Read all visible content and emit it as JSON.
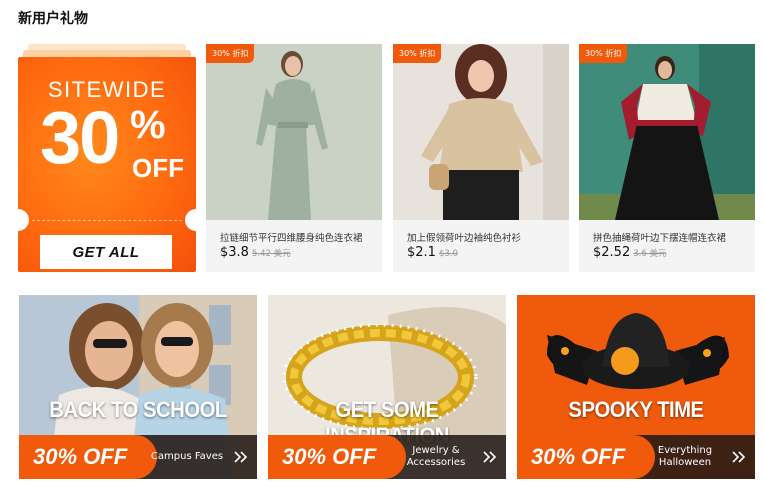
{
  "section": {
    "title": "新用户礼物"
  },
  "coupon": {
    "sitewide": "SITEWIDE",
    "number": "30",
    "percent": "%",
    "off": "OFF",
    "button": "GET ALL"
  },
  "products": [
    {
      "badge": "30% 折扣",
      "name": "拉链细节平行四维腰身纯色连衣裙",
      "price": "$3.8",
      "old_price": "5.42 美元"
    },
    {
      "badge": "30% 折扣",
      "name": "加上假领荷叶边袖纯色衬衫",
      "price": "$2.1",
      "old_price": "$3.0"
    },
    {
      "badge": "30% 折扣",
      "name": "拼色抽绳荷叶边下摆连帽连衣裙",
      "price": "$2.52",
      "old_price": "3.6 美元"
    }
  ],
  "promos": [
    {
      "headline": "BACK TO SCHOOL",
      "discount": "30% OFF",
      "sub": "Campus Faves"
    },
    {
      "headline": "GET SOME INSPIRATION",
      "discount": "30% OFF",
      "sub": "Jewelry & Accessories"
    },
    {
      "headline": "SPOOKY TIME",
      "discount": "30% OFF",
      "sub": "Everything Halloween"
    }
  ],
  "colors": {
    "accent": "#f15a0a",
    "card_bg": "#f4f4f4",
    "promo_bar": "#231914"
  },
  "icons": {
    "chevron": "chevron-double-right-icon"
  }
}
